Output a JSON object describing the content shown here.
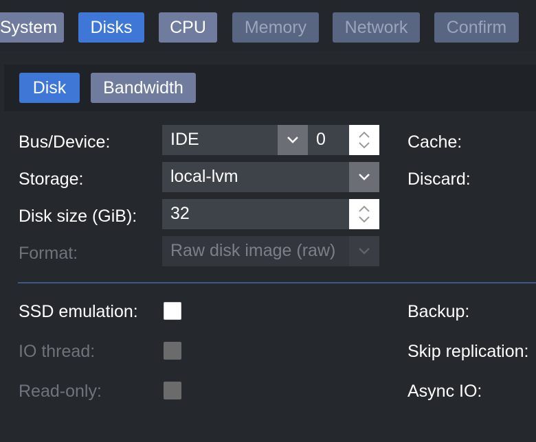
{
  "tabs": [
    {
      "label": "System",
      "state": "normal"
    },
    {
      "label": "Disks",
      "state": "active"
    },
    {
      "label": "CPU",
      "state": "normal"
    },
    {
      "label": "Memory",
      "state": "disabled"
    },
    {
      "label": "Network",
      "state": "disabled"
    },
    {
      "label": "Confirm",
      "state": "disabled"
    }
  ],
  "subtabs": [
    {
      "label": "Disk",
      "state": "active"
    },
    {
      "label": "Bandwidth",
      "state": "normal"
    }
  ],
  "form": {
    "bus_device": {
      "label": "Bus/Device:",
      "bus": "IDE",
      "device": "0"
    },
    "storage": {
      "label": "Storage:",
      "value": "local-lvm"
    },
    "disk_size": {
      "label": "Disk size (GiB):",
      "value": "32"
    },
    "format": {
      "label": "Format:",
      "value": "Raw disk image (raw)"
    },
    "cache": {
      "label": "Cache:"
    },
    "discard": {
      "label": "Discard:"
    },
    "ssd_emulation": {
      "label": "SSD emulation:",
      "checked": false
    },
    "io_thread": {
      "label": "IO thread:",
      "checked": false
    },
    "read_only": {
      "label": "Read-only:",
      "checked": false
    },
    "backup": {
      "label": "Backup:"
    },
    "skip_replication": {
      "label": "Skip replication:"
    },
    "async_io": {
      "label": "Async IO:"
    }
  },
  "colors": {
    "active_tab": "#3f77d6",
    "normal_tab": "#6f7c9d",
    "disabled_tab": "#596681",
    "background": "#25282d",
    "divider": "#3b5a8a"
  },
  "icons": {
    "dropdown": "chevron-down-icon",
    "spinner": "spinner-arrows-icon"
  }
}
